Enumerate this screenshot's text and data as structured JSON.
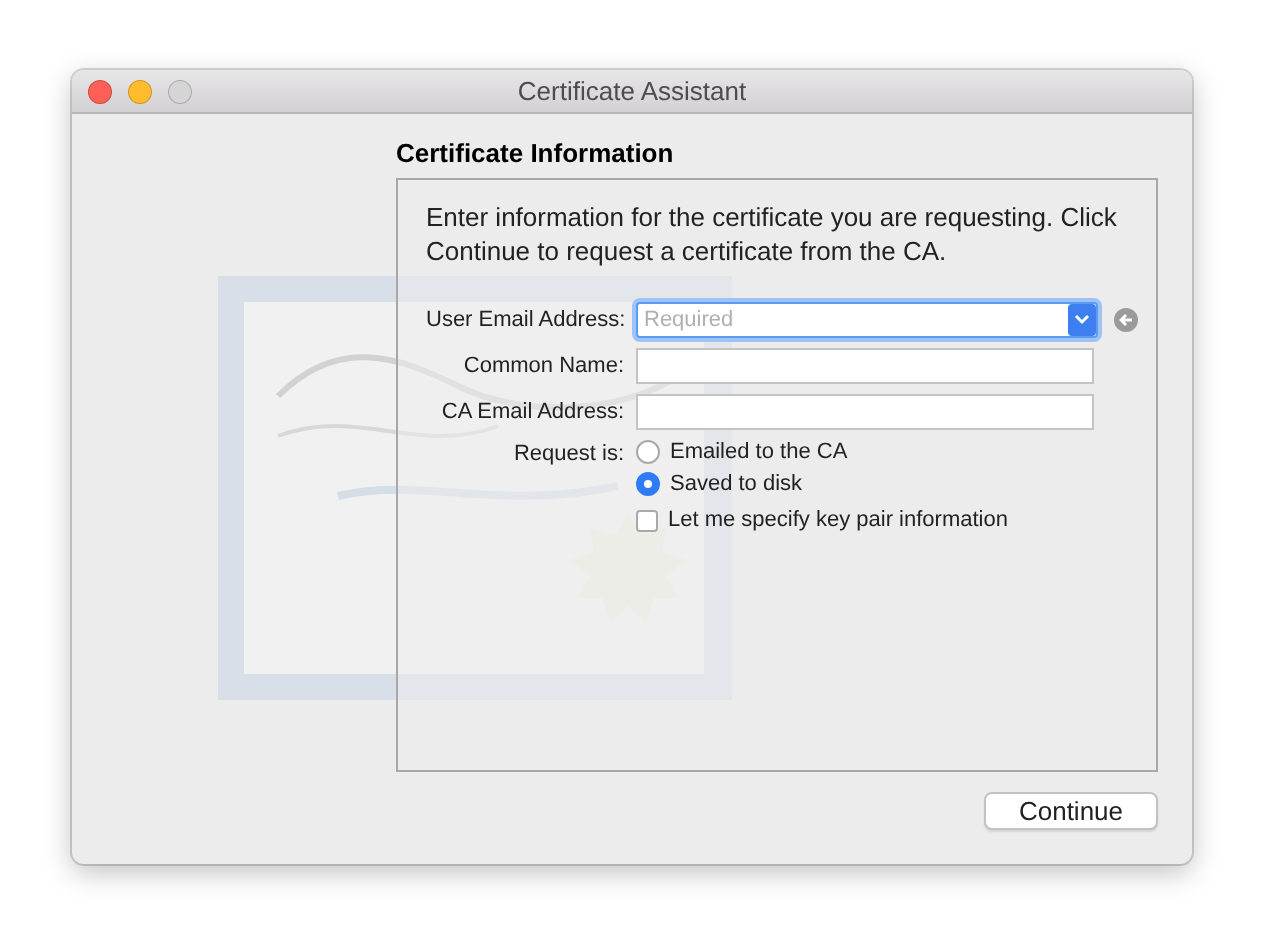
{
  "window": {
    "title": "Certificate Assistant"
  },
  "heading": "Certificate Information",
  "description": "Enter information for the certificate you are requesting. Click Continue to request a certificate from the CA.",
  "fields": [
    {
      "kind": "combo",
      "label": "User Email Address:",
      "placeholder": "Required",
      "focused": true
    },
    {
      "kind": "text",
      "label": "Common Name:",
      "focused": false
    },
    {
      "kind": "text",
      "label": "CA Email Address:",
      "focused": false
    }
  ],
  "request": {
    "label": "Request is:",
    "options": [
      {
        "label": "Emailed to the CA",
        "selected": false
      },
      {
        "label": "Saved to disk",
        "selected": true
      }
    ]
  },
  "key_pair": {
    "label": "Let me specify key pair information",
    "checked": false
  },
  "buttons": [
    "Continue"
  ]
}
